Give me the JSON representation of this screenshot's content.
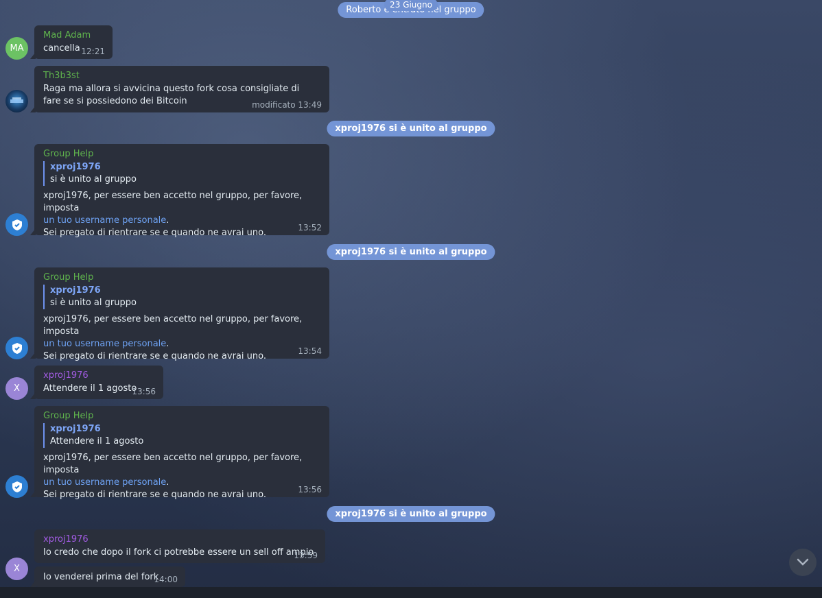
{
  "top_service": {
    "text": "Roberto è entrato nel gruppo",
    "date": "23 Giugno"
  },
  "messages": [
    {
      "sender": "Mad Adam",
      "avatar_initials": "MA",
      "text": "cancella",
      "time": "12:21"
    },
    {
      "sender": "Th3b3st",
      "text": "Raga ma allora si avvicina questo fork cosa consigliate di fare se si possiedono dei Bitcoin",
      "time": "modificato 13:49"
    },
    {
      "service": "xproj1976 si è unito al gruppo"
    },
    {
      "sender": "Group Help",
      "reply": {
        "name": "xproj1976",
        "text": "si è unito al gruppo"
      },
      "line1": "xproj1976, per essere ben accetto nel gruppo, per favore, imposta",
      "link": "un tuo username personale",
      "link_suffix": ".",
      "line3": "Sei pregato di rientrare se e quando ne avrai uno.",
      "time": "13:52"
    },
    {
      "service": "xproj1976 si è unito al gruppo"
    },
    {
      "sender": "Group Help",
      "reply": {
        "name": "xproj1976",
        "text": "si è unito al gruppo"
      },
      "line1": "xproj1976, per essere ben accetto nel gruppo, per favore, imposta",
      "link": "un tuo username personale",
      "link_suffix": ".",
      "line3": "Sei pregato di rientrare se e quando ne avrai uno.",
      "time": "13:54"
    },
    {
      "sender": "xproj1976",
      "avatar_initials": "X",
      "text": "Attendere il 1 agosto",
      "time": "13:56"
    },
    {
      "sender": "Group Help",
      "reply": {
        "name": "xproj1976",
        "text": "Attendere il 1 agosto"
      },
      "line1": "xproj1976, per essere ben accetto nel gruppo, per favore, imposta",
      "link": "un tuo username personale",
      "link_suffix": ".",
      "line3": "Sei pregato di rientrare se e quando ne avrai uno.",
      "time": "13:56"
    },
    {
      "service": "xproj1976 si è unito al gruppo"
    },
    {
      "sender": "xproj1976",
      "avatar_initials": "X",
      "text": "Io credo che dopo il fork ci potrebbe essere un sell off ampio",
      "time": "13:59"
    },
    {
      "text": "Io venderei prima del fork",
      "time": "14:00"
    }
  ],
  "icons": {
    "scroll_down": "chevron-down-icon",
    "group_help_avatar": "shield-icon"
  },
  "colors": {
    "service_pill": "#7495d6",
    "bubble": "#2a2f3b",
    "sender_green": "#5fb34d",
    "sender_purple": "#a35ce4",
    "link": "#6ea2f3"
  }
}
